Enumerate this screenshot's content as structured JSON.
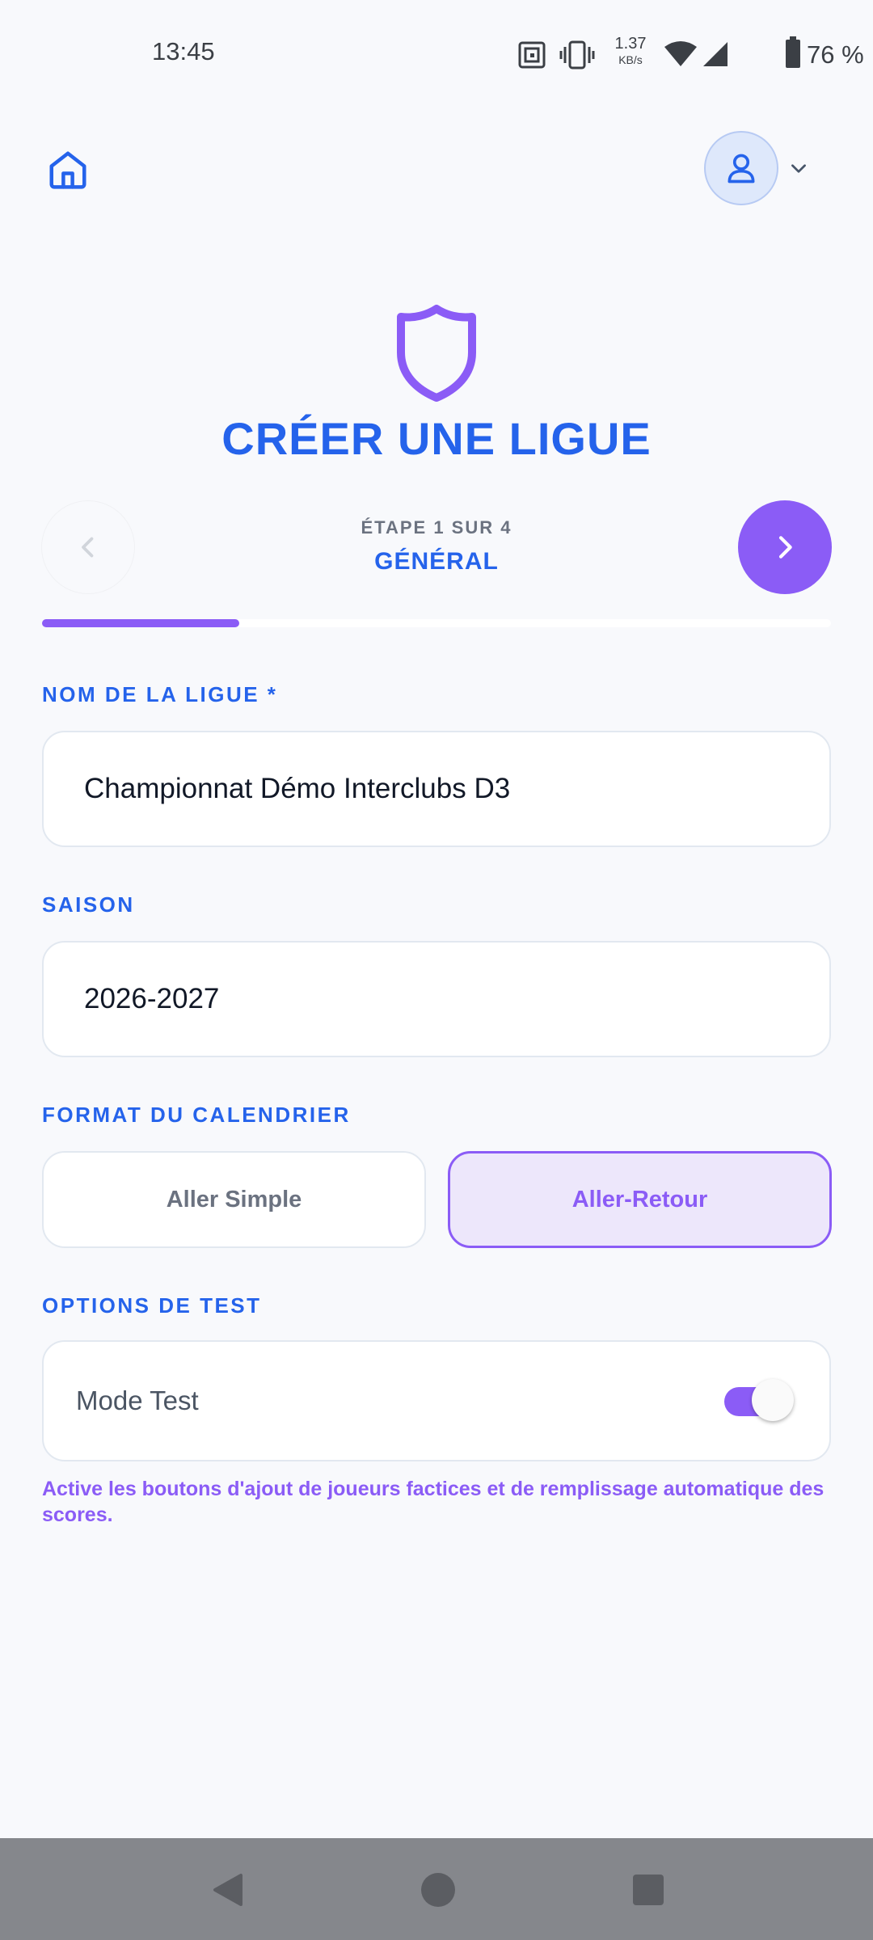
{
  "status_bar": {
    "time": "13:45",
    "net_speed_value": "1.37",
    "net_speed_unit": "KB/s",
    "battery_percent": "76 %",
    "icons": [
      "nfc-icon",
      "vibrate-icon",
      "wifi-icon",
      "cell-signal-icon",
      "battery-icon"
    ]
  },
  "header": {
    "title": "CRÉER UNE LIGUE",
    "icon": "shield-icon",
    "home_icon": "home-icon",
    "avatar_icon": "user-icon"
  },
  "stepper": {
    "step_label": "ÉTAPE 1 SUR 4",
    "step_name": "GÉNÉRAL",
    "progress_fraction": 0.25
  },
  "form": {
    "name_label": "NOM DE LA LIGUE *",
    "name_value": "Championnat Démo Interclubs D3",
    "season_label": "SAISON",
    "season_value": "2026-2027",
    "format_label": "FORMAT DU CALENDRIER",
    "format_options": [
      "Aller Simple",
      "Aller-Retour"
    ],
    "format_selected": "Aller-Retour",
    "test_label": "OPTIONS DE TEST",
    "test_mode_label": "Mode Test",
    "test_mode_on": true,
    "test_help": "Active les boutons d'ajout de joueurs factices et de remplissage automatique des scores."
  },
  "colors": {
    "primary_blue": "#2563EB",
    "accent_purple": "#8B5CF6",
    "background": "#F8F9FC"
  }
}
